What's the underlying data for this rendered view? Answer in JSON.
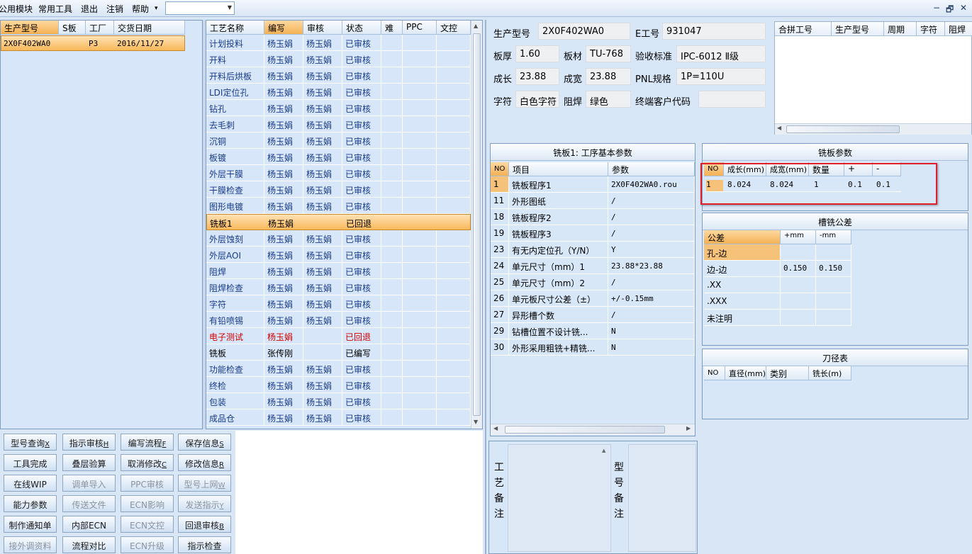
{
  "menu": {
    "items": [
      "公用模块",
      "常用工具",
      "退出",
      "注销",
      "帮助"
    ],
    "help_arrow": "▾",
    "window_controls": [
      "−",
      "🗗",
      "✕"
    ]
  },
  "left_grid": {
    "headers": [
      "生产型号",
      "S板",
      "工厂",
      "交货日期"
    ],
    "rows": [
      [
        "2X0F402WA0",
        "",
        "P3",
        "2016/11/27"
      ]
    ]
  },
  "process_grid": {
    "headers": [
      "工艺名称",
      "编写",
      "审核",
      "状态",
      "难",
      "PPC",
      "文控"
    ],
    "rows": [
      {
        "name": "计划投料",
        "writer": "杨玉娟",
        "reviewer": "杨玉娟",
        "status": "已审核"
      },
      {
        "name": "开料",
        "writer": "杨玉娟",
        "reviewer": "杨玉娟",
        "status": "已审核"
      },
      {
        "name": "开料后烘板",
        "writer": "杨玉娟",
        "reviewer": "杨玉娟",
        "status": "已审核"
      },
      {
        "name": "LDI定位孔",
        "writer": "杨玉娟",
        "reviewer": "杨玉娟",
        "status": "已审核"
      },
      {
        "name": "钻孔",
        "writer": "杨玉娟",
        "reviewer": "杨玉娟",
        "status": "已审核"
      },
      {
        "name": "去毛刺",
        "writer": "杨玉娟",
        "reviewer": "杨玉娟",
        "status": "已审核"
      },
      {
        "name": "沉铜",
        "writer": "杨玉娟",
        "reviewer": "杨玉娟",
        "status": "已审核"
      },
      {
        "name": "板镀",
        "writer": "杨玉娟",
        "reviewer": "杨玉娟",
        "status": "已审核"
      },
      {
        "name": "外层干膜",
        "writer": "杨玉娟",
        "reviewer": "杨玉娟",
        "status": "已审核"
      },
      {
        "name": "干膜检查",
        "writer": "杨玉娟",
        "reviewer": "杨玉娟",
        "status": "已审核"
      },
      {
        "name": "图形电镀",
        "writer": "杨玉娟",
        "reviewer": "杨玉娟",
        "status": "已审核"
      },
      {
        "name": "铣板1",
        "writer": "杨玉娟",
        "reviewer": "",
        "status": "已回退",
        "selected": true
      },
      {
        "name": "外层蚀刻",
        "writer": "杨玉娟",
        "reviewer": "杨玉娟",
        "status": "已审核"
      },
      {
        "name": "外层AOI",
        "writer": "杨玉娟",
        "reviewer": "杨玉娟",
        "status": "已审核"
      },
      {
        "name": "阻焊",
        "writer": "杨玉娟",
        "reviewer": "杨玉娟",
        "status": "已审核"
      },
      {
        "name": "阻焊检查",
        "writer": "杨玉娟",
        "reviewer": "杨玉娟",
        "status": "已审核"
      },
      {
        "name": "字符",
        "writer": "杨玉娟",
        "reviewer": "杨玉娟",
        "status": "已审核"
      },
      {
        "name": "有铅喷锡",
        "writer": "杨玉娟",
        "reviewer": "杨玉娟",
        "status": "已审核"
      },
      {
        "name": "电子测试",
        "writer": "杨玉娟",
        "reviewer": "",
        "status": "已回退",
        "red": true
      },
      {
        "name": "铣板",
        "writer": "张传刚",
        "reviewer": "",
        "status": "已编写",
        "plain": true
      },
      {
        "name": "功能检查",
        "writer": "杨玉娟",
        "reviewer": "杨玉娟",
        "status": "已审核"
      },
      {
        "name": "终检",
        "writer": "杨玉娟",
        "reviewer": "杨玉娟",
        "status": "已审核"
      },
      {
        "name": "包装",
        "writer": "杨玉娟",
        "reviewer": "杨玉娟",
        "status": "已审核"
      },
      {
        "name": "成品仓",
        "writer": "杨玉娟",
        "reviewer": "杨玉娟",
        "status": "已审核"
      }
    ]
  },
  "buttons": [
    [
      {
        "t": "型号查询",
        "k": "X"
      },
      {
        "t": "指示审核",
        "k": "H"
      },
      {
        "t": "编写流程",
        "k": "F"
      },
      {
        "t": "保存信息",
        "k": "S"
      }
    ],
    [
      {
        "t": "工具完成",
        "k": ""
      },
      {
        "t": "叠层验算",
        "k": ""
      },
      {
        "t": "取消修改",
        "k": "C"
      },
      {
        "t": "修改信息",
        "k": "R"
      }
    ],
    [
      {
        "t": "在线WIP",
        "k": ""
      },
      {
        "t": "调单导入",
        "k": "",
        "dis": true
      },
      {
        "t": "PPC审核",
        "k": "",
        "dis": true
      },
      {
        "t": "型号上网",
        "k": "W",
        "dis": true
      }
    ],
    [
      {
        "t": "能力参数",
        "k": ""
      },
      {
        "t": "传送文件",
        "k": "",
        "dis": true
      },
      {
        "t": "ECN影响",
        "k": "",
        "dis": true
      },
      {
        "t": "发送指示",
        "k": "Y",
        "dis": true
      }
    ],
    [
      {
        "t": "制作通知单",
        "k": ""
      },
      {
        "t": "内部ECN",
        "k": ""
      },
      {
        "t": "ECN文控",
        "k": "",
        "dis": true
      },
      {
        "t": "回退审核",
        "k": "B"
      }
    ],
    [
      {
        "t": "接外调资料",
        "k": "",
        "dis": true
      },
      {
        "t": "流程对比",
        "k": ""
      },
      {
        "t": "ECN升级",
        "k": "",
        "dis": true
      },
      {
        "t": "指示检查",
        "k": ""
      }
    ]
  ],
  "info": {
    "model_label": "生产型号",
    "model_value": "2X0F402WA0",
    "e_label": "E工号",
    "e_value": "931047",
    "thick_label": "板厚",
    "thick_value": "1.60",
    "material_label": "板材",
    "material_value": "TU-768",
    "standard_label": "验收标准",
    "standard_value": "IPC-6012 Ⅱ级",
    "len_label": "成长",
    "len_value": "23.88",
    "wid_label": "成宽",
    "wid_value": "23.88",
    "pnl_label": "PNL规格",
    "pnl_value": "1P=110U",
    "char_label": "字符",
    "char_value": "白色字符",
    "mask_label": "阻焊",
    "mask_value": "绿色",
    "client_label": "终端客户代码",
    "client_value": ""
  },
  "merge_grid": {
    "headers": [
      "合拼工号",
      "生产型号",
      "周期",
      "字符",
      "阻焊"
    ]
  },
  "base_params": {
    "title": "铣板1: 工序基本参数",
    "headers": [
      "NO",
      "项目",
      "参数"
    ],
    "rows": [
      [
        "1",
        "铣板程序1",
        "2X0F402WA0.rou"
      ],
      [
        "11",
        "外形图纸",
        "/"
      ],
      [
        "18",
        "铣板程序2",
        "/"
      ],
      [
        "19",
        "铣板程序3",
        "/"
      ],
      [
        "23",
        "有无内定位孔（Y/N）",
        "Y"
      ],
      [
        "24",
        "单元尺寸（mm）1",
        "23.88*23.88"
      ],
      [
        "25",
        "单元尺寸（mm）2",
        "/"
      ],
      [
        "26",
        "单元板尺寸公差（±）",
        "+/-0.15mm"
      ],
      [
        "27",
        "异形槽个数",
        "/"
      ],
      [
        "29",
        "钻槽位置不设计铣...",
        "N"
      ],
      [
        "30",
        "外形采用粗铣+精铣...",
        "N"
      ]
    ]
  },
  "mill_params": {
    "title": "铣板参数",
    "headers": [
      "NO",
      "成长(mm)",
      "成宽(mm)",
      "数量",
      "+",
      "-"
    ],
    "rows": [
      [
        "1",
        "8.024",
        "8.024",
        "1",
        "0.1",
        "0.1"
      ]
    ]
  },
  "slot_tol": {
    "title": "槽铣公差",
    "headers": [
      "公差",
      "+mm",
      "-mm"
    ],
    "rows": [
      [
        "孔-边",
        "",
        ""
      ],
      [
        "边-边",
        "0.150",
        "0.150"
      ],
      [
        ".XX",
        "",
        ""
      ],
      [
        ".XXX",
        "",
        ""
      ],
      [
        "未注明",
        "",
        ""
      ]
    ]
  },
  "tool_table": {
    "title": "刀径表",
    "headers": [
      "NO",
      "直径(mm)",
      "类别",
      "铣长(m)"
    ]
  },
  "notes": {
    "process_label": "工艺备注",
    "model_label": "型号备注"
  },
  "colors": {
    "accent_orange": "#f5b04e",
    "highlight_red": "#e0202a",
    "link_blue": "#1a3c8a"
  }
}
